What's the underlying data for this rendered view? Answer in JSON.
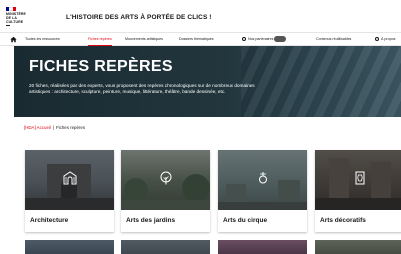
{
  "header": {
    "logo_text": [
      "MINISTÈRE",
      "DE LA CULTURE"
    ],
    "title": "L'HISTOIRE DES ARTS À PORTÉE DE CLICS !"
  },
  "nav": {
    "items": [
      {
        "label": "Toutes les ressources"
      },
      {
        "label": "Fiches repères",
        "active": true
      },
      {
        "label": "Mouvements artistiques"
      },
      {
        "label": "Dossiers thématiques"
      },
      {
        "label": "Nos partenaires"
      },
      {
        "label": "Contenus réutilisables"
      },
      {
        "label": "À propos"
      }
    ]
  },
  "banner": {
    "title": "FICHES REPÈRES",
    "description": "20 fiches, réalisées par des experts, vous proposent des repères chronologiques sur de nombreux domaines artistiques : architecture, sculpture, peinture, musique, littérature, théâtre, bande dessinée, etc."
  },
  "breadcrumb": {
    "home": "[HDA] Accueil",
    "separator": "|",
    "current": "Fiches repères"
  },
  "cards": [
    {
      "label": "Architecture",
      "icon": "arch-monument-icon"
    },
    {
      "label": "Arts des jardins",
      "icon": "tree-icon"
    },
    {
      "label": "Arts du cirque",
      "icon": "juggler-icon"
    },
    {
      "label": "Arts décoratifs",
      "icon": "vase-icon"
    }
  ],
  "colors": {
    "accent": "#e1000f",
    "flag_blue": "#000091",
    "flag_red": "#e1000f",
    "banner": "#1f3038"
  }
}
